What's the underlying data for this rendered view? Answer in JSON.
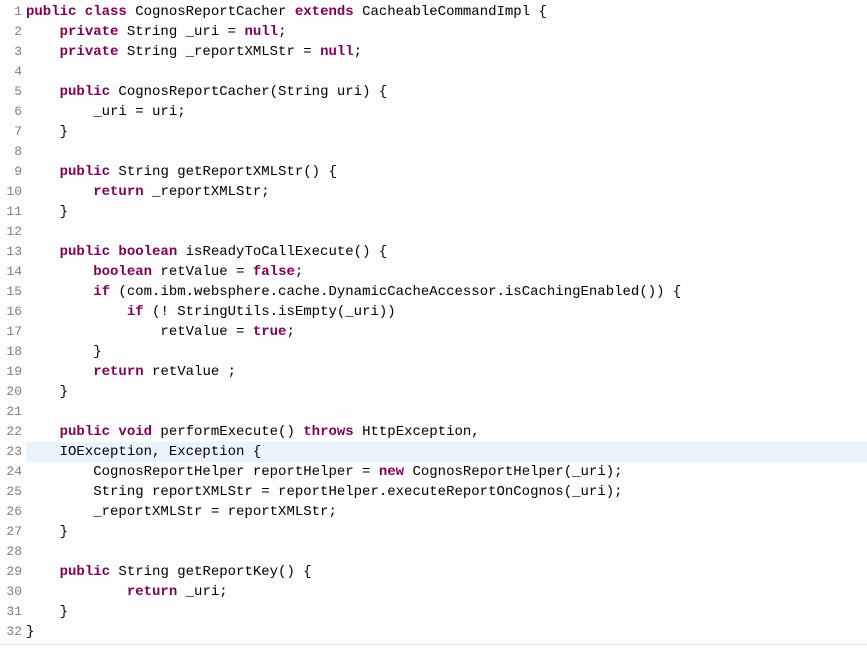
{
  "lineCount": 32,
  "highlightLine": 23,
  "tokens": {
    "l1": [
      {
        "t": "public class ",
        "c": "kw"
      },
      {
        "t": "CognosReportCacher ",
        "c": "pl"
      },
      {
        "t": "extends",
        "c": "kw"
      },
      {
        "t": " CacheableCommandImpl {",
        "c": "pl"
      }
    ],
    "l2": [
      {
        "t": "    ",
        "c": "pl"
      },
      {
        "t": "private",
        "c": "kw"
      },
      {
        "t": " String _uri = ",
        "c": "pl"
      },
      {
        "t": "null",
        "c": "kw"
      },
      {
        "t": ";",
        "c": "pl"
      }
    ],
    "l3": [
      {
        "t": "    ",
        "c": "pl"
      },
      {
        "t": "private",
        "c": "kw"
      },
      {
        "t": " String _reportXMLStr = ",
        "c": "pl"
      },
      {
        "t": "null",
        "c": "kw"
      },
      {
        "t": ";",
        "c": "pl"
      }
    ],
    "l4": [
      {
        "t": " ",
        "c": "pl"
      }
    ],
    "l5": [
      {
        "t": "    ",
        "c": "pl"
      },
      {
        "t": "public",
        "c": "kw"
      },
      {
        "t": " CognosReportCacher(String uri) {",
        "c": "pl"
      }
    ],
    "l6": [
      {
        "t": "        _uri = uri;",
        "c": "pl"
      }
    ],
    "l7": [
      {
        "t": "    }",
        "c": "pl"
      }
    ],
    "l8": [
      {
        "t": " ",
        "c": "pl"
      }
    ],
    "l9": [
      {
        "t": "    ",
        "c": "pl"
      },
      {
        "t": "public",
        "c": "kw"
      },
      {
        "t": " String getReportXMLStr() {",
        "c": "pl"
      }
    ],
    "l10": [
      {
        "t": "        ",
        "c": "pl"
      },
      {
        "t": "return",
        "c": "kw"
      },
      {
        "t": " _reportXMLStr;",
        "c": "pl"
      }
    ],
    "l11": [
      {
        "t": "    }",
        "c": "pl"
      }
    ],
    "l12": [
      {
        "t": " ",
        "c": "pl"
      }
    ],
    "l13": [
      {
        "t": "    ",
        "c": "pl"
      },
      {
        "t": "public boolean",
        "c": "kw"
      },
      {
        "t": " isReadyToCallExecute() {",
        "c": "pl"
      }
    ],
    "l14": [
      {
        "t": "        ",
        "c": "pl"
      },
      {
        "t": "boolean",
        "c": "kw"
      },
      {
        "t": " retValue = ",
        "c": "pl"
      },
      {
        "t": "false",
        "c": "kw"
      },
      {
        "t": ";",
        "c": "pl"
      }
    ],
    "l15": [
      {
        "t": "        ",
        "c": "pl"
      },
      {
        "t": "if",
        "c": "kw"
      },
      {
        "t": " (com.ibm.websphere.cache.DynamicCacheAccessor.isCachingEnabled()) {",
        "c": "pl"
      }
    ],
    "l16": [
      {
        "t": "            ",
        "c": "pl"
      },
      {
        "t": "if",
        "c": "kw"
      },
      {
        "t": " (! StringUtils.isEmpty(_uri))",
        "c": "pl"
      }
    ],
    "l17": [
      {
        "t": "                retValue = ",
        "c": "pl"
      },
      {
        "t": "true",
        "c": "kw"
      },
      {
        "t": ";",
        "c": "pl"
      }
    ],
    "l18": [
      {
        "t": "        }",
        "c": "pl"
      }
    ],
    "l19": [
      {
        "t": "        ",
        "c": "pl"
      },
      {
        "t": "return",
        "c": "kw"
      },
      {
        "t": " retValue ;",
        "c": "pl"
      }
    ],
    "l20": [
      {
        "t": "    }",
        "c": "pl"
      }
    ],
    "l21": [
      {
        "t": " ",
        "c": "pl"
      }
    ],
    "l22": [
      {
        "t": "    ",
        "c": "pl"
      },
      {
        "t": "public void",
        "c": "kw"
      },
      {
        "t": " performExecute() ",
        "c": "pl"
      },
      {
        "t": "throws",
        "c": "kw"
      },
      {
        "t": " HttpException,",
        "c": "pl"
      }
    ],
    "l23": [
      {
        "t": "    IOException, Exception {",
        "c": "pl"
      }
    ],
    "l24": [
      {
        "t": "        CognosReportHelper reportHelper = ",
        "c": "pl"
      },
      {
        "t": "new",
        "c": "kw"
      },
      {
        "t": " CognosReportHelper(_uri);",
        "c": "pl"
      }
    ],
    "l25": [
      {
        "t": "        String reportXMLStr = reportHelper.executeReportOnCognos(_uri);",
        "c": "pl"
      }
    ],
    "l26": [
      {
        "t": "        _reportXMLStr = reportXMLStr;",
        "c": "pl"
      }
    ],
    "l27": [
      {
        "t": "    }",
        "c": "pl"
      }
    ],
    "l28": [
      {
        "t": " ",
        "c": "pl"
      }
    ],
    "l29": [
      {
        "t": "    ",
        "c": "pl"
      },
      {
        "t": "public",
        "c": "kw"
      },
      {
        "t": " String getReportKey() {",
        "c": "pl"
      }
    ],
    "l30": [
      {
        "t": "            ",
        "c": "pl"
      },
      {
        "t": "return",
        "c": "kw"
      },
      {
        "t": " _uri;",
        "c": "pl"
      }
    ],
    "l31": [
      {
        "t": "    }",
        "c": "pl"
      }
    ],
    "l32": [
      {
        "t": "}",
        "c": "pl"
      }
    ]
  }
}
